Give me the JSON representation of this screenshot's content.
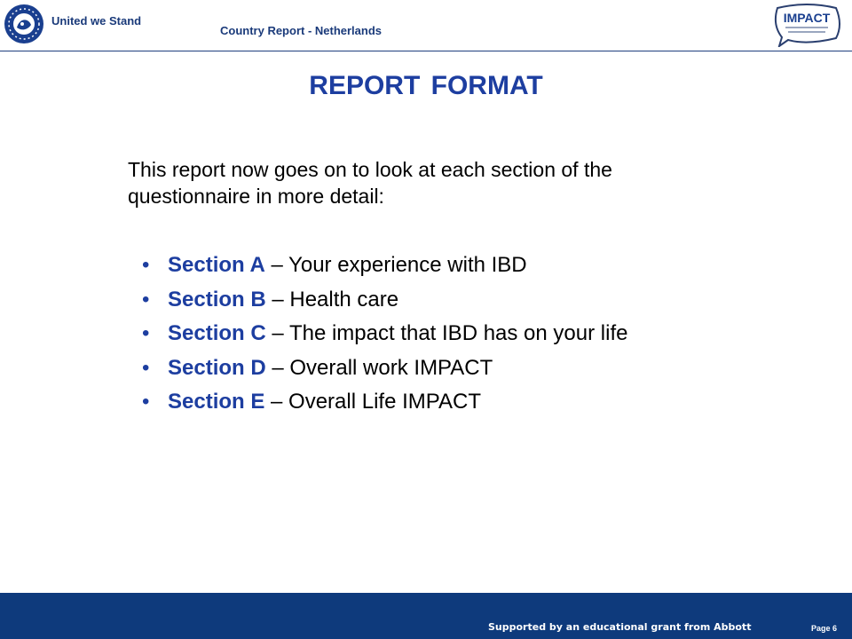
{
  "header": {
    "org_name": "United we Stand",
    "report_title": "Country Report - Netherlands",
    "right_logo_text": "IMPACT"
  },
  "slide": {
    "title": "REPORT FORMAT",
    "intro": "This report now goes on to look at each section of the questionnaire in more detail:",
    "sections": [
      {
        "name": "Section A",
        "desc": " – Your experience with IBD"
      },
      {
        "name": "Section B",
        "desc": " – Health care"
      },
      {
        "name": "Section C",
        "desc": " – The impact that IBD has on your life"
      },
      {
        "name": "Section D",
        "desc": " – Overall work IMPACT"
      },
      {
        "name": "Section E",
        "desc": " – Overall Life IMPACT"
      }
    ]
  },
  "footer": {
    "support_text": "Supported by an educational grant from Abbott",
    "page_label": "Page 6"
  },
  "colors": {
    "accent": "#1d3ea0",
    "footer_bg": "#0e3a7c"
  }
}
